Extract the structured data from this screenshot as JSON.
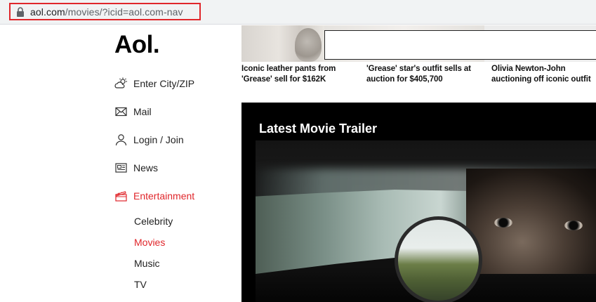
{
  "browser": {
    "url_domain": "aol.com",
    "url_path": "/movies/?icid=aol.com-nav"
  },
  "logo": "Aol.",
  "nav": {
    "items": [
      {
        "label": "Enter City/ZIP",
        "icon": "weather-icon"
      },
      {
        "label": "Mail",
        "icon": "mail-icon"
      },
      {
        "label": "Login / Join",
        "icon": "user-icon"
      },
      {
        "label": "News",
        "icon": "news-icon"
      },
      {
        "label": "Entertainment",
        "icon": "entertainment-icon",
        "active": true
      }
    ],
    "sub_items": [
      {
        "label": "Celebrity"
      },
      {
        "label": "Movies",
        "active": true
      },
      {
        "label": "Music"
      },
      {
        "label": "TV"
      }
    ]
  },
  "headlines": [
    {
      "line1": "Iconic leather pants from",
      "line2": "'Grease' sell for $162K"
    },
    {
      "line1": "'Grease' star's outfit sells at",
      "line2": "auction for $405,700"
    },
    {
      "line1": "Olivia Newton-John",
      "line2": "auctioning off iconic outfit"
    }
  ],
  "trailer": {
    "title": "Latest Movie Trailer"
  },
  "colors": {
    "accent": "#e0262b",
    "trailer_bg": "#000000"
  }
}
